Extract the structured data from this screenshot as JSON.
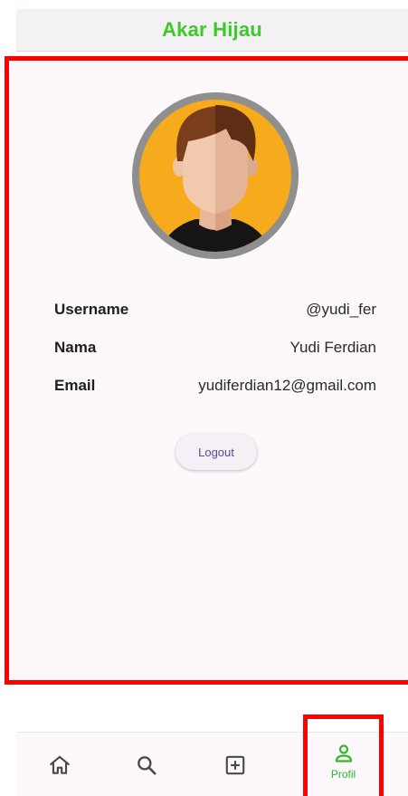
{
  "appbar": {
    "title": "Akar Hijau"
  },
  "profile": {
    "rows": [
      {
        "label": "Username",
        "value": "@yudi_fer"
      },
      {
        "label": "Nama",
        "value": "Yudi Ferdian"
      },
      {
        "label": "Email",
        "value": "yudiferdian12@gmail.com"
      }
    ],
    "logout_label": "Logout"
  },
  "bottom_nav": {
    "items": [
      {
        "icon": "home-icon"
      },
      {
        "icon": "search-icon"
      },
      {
        "icon": "add-box-icon"
      },
      {
        "icon": "person-icon",
        "label": "Profil",
        "selected": true
      }
    ]
  },
  "colors": {
    "brand_green": "#3cc92c",
    "highlight_red": "#ff0000",
    "avatar_background": "#f6ab1c"
  }
}
